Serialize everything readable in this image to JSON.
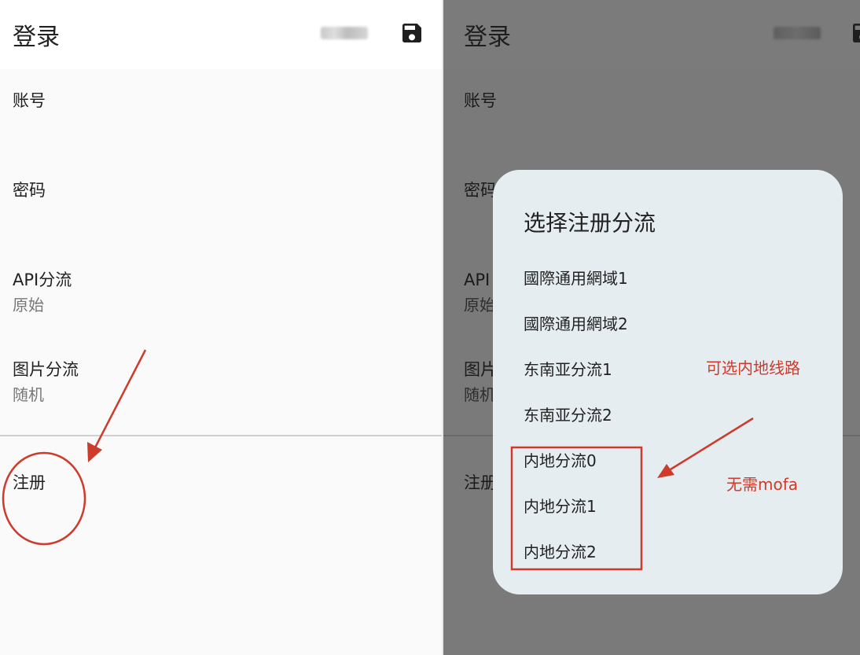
{
  "left_screen": {
    "title": "登录",
    "preferences": [
      {
        "title": "账号",
        "summary": ""
      },
      {
        "title": "密码",
        "summary": ""
      },
      {
        "title": "API分流",
        "summary": "原始"
      },
      {
        "title": "图片分流",
        "summary": "随机"
      }
    ],
    "register_label": "注册"
  },
  "right_screen": {
    "title": "登录",
    "preferences": [
      {
        "title": "账号",
        "summary": ""
      },
      {
        "title": "密码",
        "summary": ""
      },
      {
        "title": "API",
        "summary": "原始"
      },
      {
        "title": "图片",
        "summary": "随机"
      }
    ],
    "register_label": "注册"
  },
  "dialog": {
    "title": "选择注册分流",
    "options": [
      "國際通用網域1",
      "國際通用網域2",
      "东南亚分流1",
      "东南亚分流2",
      "内地分流0",
      "内地分流1",
      "内地分流2"
    ]
  },
  "annotations": {
    "mainland_note": "可选内地线路",
    "no_vpn_note": "无需mofa"
  },
  "icons": {
    "save": "floppy-disk-icon"
  },
  "colors": {
    "annotation": "#cc3b2c",
    "dialog_bg": "#e6edf1",
    "dim_overlay": "#7a7a7a"
  }
}
